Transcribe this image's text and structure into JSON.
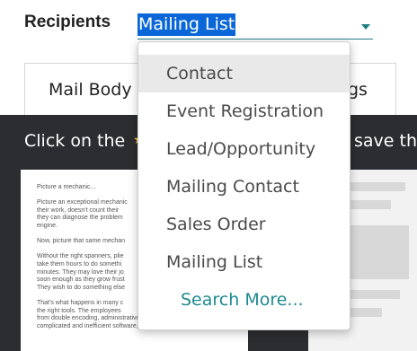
{
  "form": {
    "recipients_label": "Recipients",
    "recipients_value": "Mailing List"
  },
  "tabs": {
    "mail_body": "Mail Body",
    "settings_partial": "gs"
  },
  "instructions": {
    "left": "Click on the",
    "right": "save th"
  },
  "dropdown": {
    "items": [
      "Contact",
      "Event Registration",
      "Lead/Opportunity",
      "Mailing Contact",
      "Sales Order",
      "Mailing List"
    ],
    "search_more": "Search More..."
  },
  "preview": {
    "text": "Picture a mechanic...\n\nPicture an exceptional mechanic\ntheir work, doesn't count their\nthey can diagnose the problem\nengine.\n\nNow, picture that same mechan\n\nWithout the right spanners, plie\ntake them hours to do somethi\nminutes. They may love their jo\nsoon enough as they grow frust\nThey wish to do something else\n\nThat's what happens in many c\nthe right tools. The employees\nfrom double encoding, administrative tasks, overly\ncomplicated and inefficient software, outdated inventory"
  },
  "colors": {
    "accent": "#1e7c84",
    "selection": "#0a67d8",
    "dark_band": "#2b2d31",
    "link": "#1e8a8e"
  }
}
